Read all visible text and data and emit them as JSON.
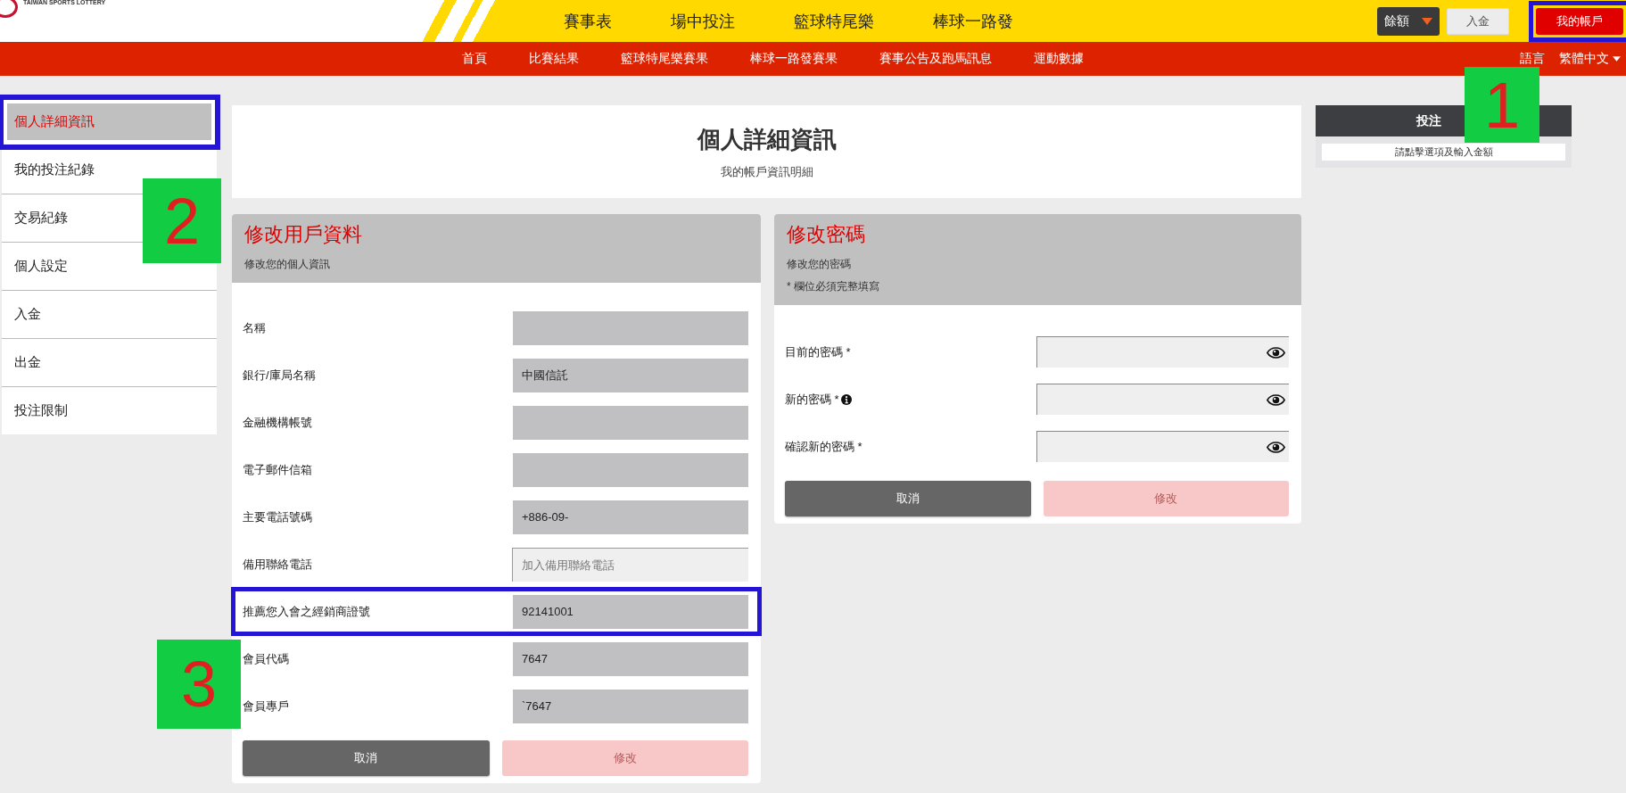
{
  "logo": {
    "text": "TAIWAN SPORTS LOTTERY"
  },
  "top_nav": [
    {
      "label": "賽事表"
    },
    {
      "label": "場中投注"
    },
    {
      "label": "籃球特尾樂"
    },
    {
      "label": "棒球一路發"
    }
  ],
  "account": {
    "balance_label": "餘額",
    "deposit_label": "入金",
    "account_label": "我的帳戶",
    "highlighted": true
  },
  "sub_nav": [
    {
      "label": "首頁"
    },
    {
      "label": "比賽結果"
    },
    {
      "label": "籃球特尾樂賽果"
    },
    {
      "label": "棒球一路發賽果"
    },
    {
      "label": "賽事公告及跑馬訊息"
    },
    {
      "label": "運動數據"
    }
  ],
  "language": {
    "label": "語言",
    "value": "繁體中文"
  },
  "sidebar": [
    {
      "label": "個人詳細資訊",
      "selected": true,
      "highlighted": true
    },
    {
      "label": "我的投注紀錄",
      "selected": false,
      "highlighted": false
    },
    {
      "label": "交易紀錄",
      "selected": false,
      "highlighted": false
    },
    {
      "label": "個人設定",
      "selected": false,
      "highlighted": false
    },
    {
      "label": "入金",
      "selected": false,
      "highlighted": false
    },
    {
      "label": "出金",
      "selected": false,
      "highlighted": false
    },
    {
      "label": "投注限制",
      "selected": false,
      "highlighted": false
    }
  ],
  "page_header": {
    "title": "個人詳細資訊",
    "subtitle": "我的帳戶資訊明細"
  },
  "profile_form": {
    "title": "修改用戶資料",
    "subtitle": "修改您的個人資訊",
    "fields": [
      {
        "label": "名稱",
        "disabled": true,
        "highlighted": false
      },
      {
        "label": "銀行/庫局名稱",
        "value": "中國信託",
        "disabled": true,
        "highlighted": false
      },
      {
        "label": "金融機構帳號",
        "disabled": true,
        "highlighted": false
      },
      {
        "label": "電子郵件信箱",
        "disabled": true,
        "highlighted": false
      },
      {
        "label": "主要電話號碼",
        "value": "+886-09-",
        "disabled": true,
        "highlighted": false
      },
      {
        "label": "備用聯絡電話",
        "placeholder": "加入備用聯絡電話",
        "disabled": false,
        "highlighted": false
      },
      {
        "label": "推薦您入會之經銷商證號",
        "value": "92141001",
        "disabled": true,
        "highlighted": true
      },
      {
        "label": "會員代碼",
        "value": "7647",
        "disabled": true,
        "highlighted": false
      },
      {
        "label": "會員專戶",
        "value": "`7647",
        "disabled": true,
        "highlighted": false
      }
    ],
    "cancel": {
      "label": "取消",
      "disabled": false
    },
    "submit": {
      "label": "修改",
      "disabled": true
    }
  },
  "password_form": {
    "title": "修改密碼",
    "subtitle": "修改您的密碼",
    "note": "* 欄位必須完整填寫",
    "fields": [
      {
        "label": "目前的密碼 *",
        "info": false
      },
      {
        "label": "新的密碼 *",
        "info": true
      },
      {
        "label": "確認新的密碼 *",
        "info": false
      }
    ],
    "cancel": {
      "label": "取消",
      "disabled": false
    },
    "submit": {
      "label": "修改",
      "disabled": true
    }
  },
  "bet_slip": {
    "title": "投注",
    "hint": "請點擊選項及輸入金額"
  },
  "annotations": [
    {
      "label": "1"
    },
    {
      "label": "2"
    },
    {
      "label": "3"
    }
  ]
}
